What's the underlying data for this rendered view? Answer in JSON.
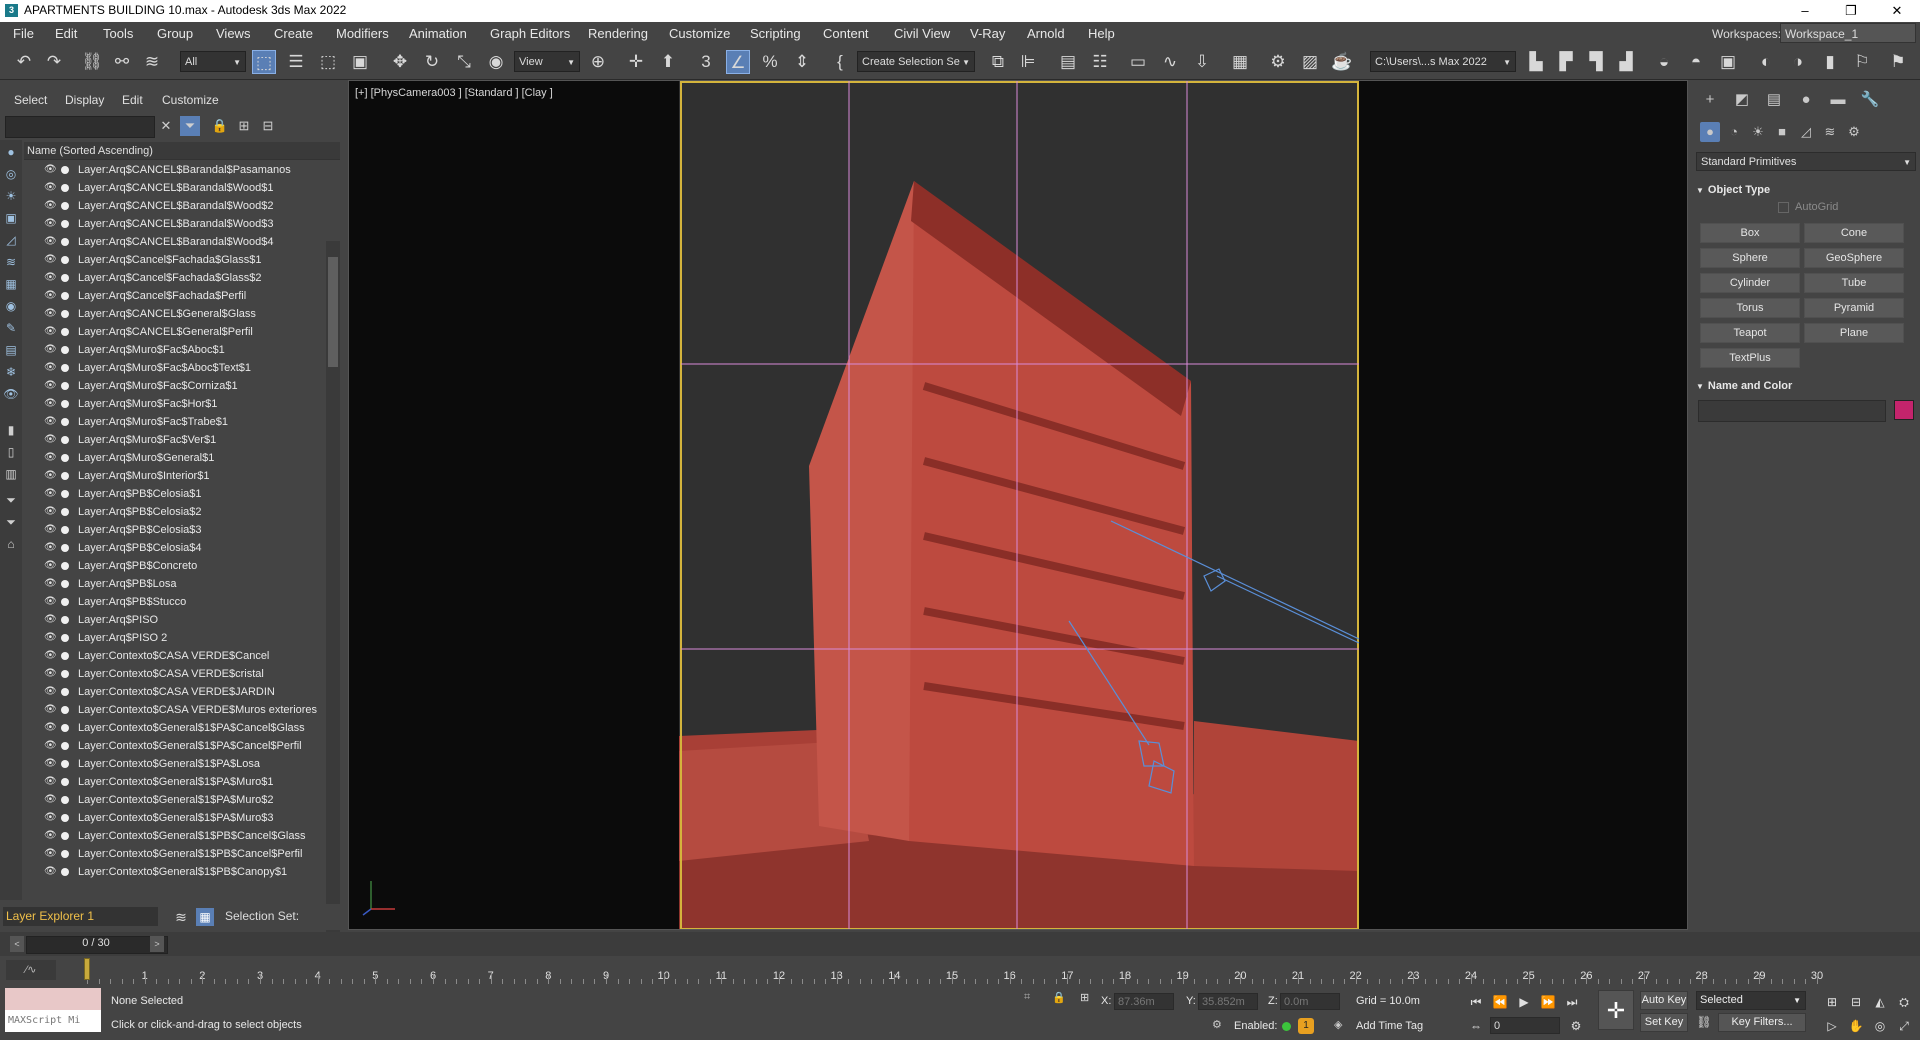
{
  "window": {
    "title": "APARTMENTS BUILDING 10.max - Autodesk 3ds Max 2022",
    "app_icon": "3",
    "minimize": "–",
    "maximize": "❐",
    "close": "✕"
  },
  "menubar": {
    "items": [
      "File",
      "Edit",
      "Tools",
      "Group",
      "Views",
      "Create",
      "Modifiers",
      "Animation",
      "Graph Editors",
      "Rendering",
      "Customize",
      "Scripting",
      "Content",
      "Civil View",
      "V-Ray",
      "Arnold",
      "Help"
    ],
    "workspaces_label": "Workspaces:",
    "workspace_value": "Workspace_1"
  },
  "toolbar": {
    "selection_filter": "All",
    "ref_coord": "View",
    "named_selection": "Create Selection Se",
    "project_path": "C:\\Users\\...s Max 2022",
    "icons": [
      "undo-icon",
      "redo-icon",
      "link-icon",
      "unlink-icon",
      "bind-space-warp-icon"
    ]
  },
  "scene_explorer": {
    "menu": [
      "Select",
      "Display",
      "Edit",
      "Customize"
    ],
    "column_header": "Name (Sorted Ascending)",
    "layers": [
      "Layer:Arq$CANCEL$Barandal$Pasamanos",
      "Layer:Arq$CANCEL$Barandal$Wood$1",
      "Layer:Arq$CANCEL$Barandal$Wood$2",
      "Layer:Arq$CANCEL$Barandal$Wood$3",
      "Layer:Arq$CANCEL$Barandal$Wood$4",
      "Layer:Arq$Cancel$Fachada$Glass$1",
      "Layer:Arq$Cancel$Fachada$Glass$2",
      "Layer:Arq$Cancel$Fachada$Perfil",
      "Layer:Arq$CANCEL$General$Glass",
      "Layer:Arq$CANCEL$General$Perfil",
      "Layer:Arq$Muro$Fac$Aboc$1",
      "Layer:Arq$Muro$Fac$Aboc$Text$1",
      "Layer:Arq$Muro$Fac$Corniza$1",
      "Layer:Arq$Muro$Fac$Hor$1",
      "Layer:Arq$Muro$Fac$Trabe$1",
      "Layer:Arq$Muro$Fac$Ver$1",
      "Layer:Arq$Muro$General$1",
      "Layer:Arq$Muro$Interior$1",
      "Layer:Arq$PB$Celosia$1",
      "Layer:Arq$PB$Celosia$2",
      "Layer:Arq$PB$Celosia$3",
      "Layer:Arq$PB$Celosia$4",
      "Layer:Arq$PB$Concreto",
      "Layer:Arq$PB$Losa",
      "Layer:Arq$PB$Stucco",
      "Layer:Arq$PISO",
      "Layer:Arq$PISO 2",
      "Layer:Contexto$CASA VERDE$Cancel",
      "Layer:Contexto$CASA VERDE$cristal",
      "Layer:Contexto$CASA VERDE$JARDIN",
      "Layer:Contexto$CASA VERDE$Muros exteriores",
      "Layer:Contexto$General$1$PA$Cancel$Glass",
      "Layer:Contexto$General$1$PA$Cancel$Perfil",
      "Layer:Contexto$General$1$PA$Losa",
      "Layer:Contexto$General$1$PA$Muro$1",
      "Layer:Contexto$General$1$PA$Muro$2",
      "Layer:Contexto$General$1$PA$Muro$3",
      "Layer:Contexto$General$1$PB$Cancel$Glass",
      "Layer:Contexto$General$1$PB$Cancel$Perfil",
      "Layer:Contexto$General$1$PB$Canopy$1"
    ],
    "footer_layer": "Layer Explorer 1",
    "selection_set_label": "Selection Set:"
  },
  "viewport": {
    "label": "[+] [PhysCamera003 ] [Standard ] [Clay ]",
    "building_color": "#b8473d",
    "safe_frame_color": "#d4b43c",
    "camera_color": "#5a8fd8"
  },
  "command_panel": {
    "dropdown": "Standard Primitives",
    "object_type_title": "Object Type",
    "autogrid": "AutoGrid",
    "primitives": [
      "Box",
      "Cone",
      "Sphere",
      "GeoSphere",
      "Cylinder",
      "Tube",
      "Torus",
      "Pyramid",
      "Teapot",
      "Plane",
      "TextPlus"
    ],
    "name_color_title": "Name and Color",
    "object_color": "#c4246c"
  },
  "time_slider": {
    "frame_label": "0 / 30",
    "prev": "<",
    "next": ">"
  },
  "trackbar": {
    "frames": [
      "0",
      "1",
      "2",
      "3",
      "4",
      "5",
      "6",
      "7",
      "8",
      "9",
      "10",
      "11",
      "12",
      "13",
      "14",
      "15",
      "16",
      "17",
      "18",
      "19",
      "20",
      "21",
      "22",
      "23",
      "24",
      "25",
      "26",
      "27",
      "28",
      "29",
      "30"
    ]
  },
  "statusbar": {
    "maxscript_placeholder": "MAXScript Mi",
    "selection_status": "None Selected",
    "prompt": "Click or click-and-drag to select objects",
    "x_label": "X:",
    "x_value": "87.36m",
    "y_label": "Y:",
    "y_value": "35.852m",
    "z_label": "Z:",
    "z_value": "0.0m",
    "grid": "Grid = 10.0m",
    "enabled_label": "Enabled:",
    "add_time_tag": "Add Time Tag",
    "auto_key": "Auto Key",
    "set_key": "Set Key",
    "key_mode": "Selected",
    "key_filters": "Key Filters...",
    "current_frame": "0"
  }
}
